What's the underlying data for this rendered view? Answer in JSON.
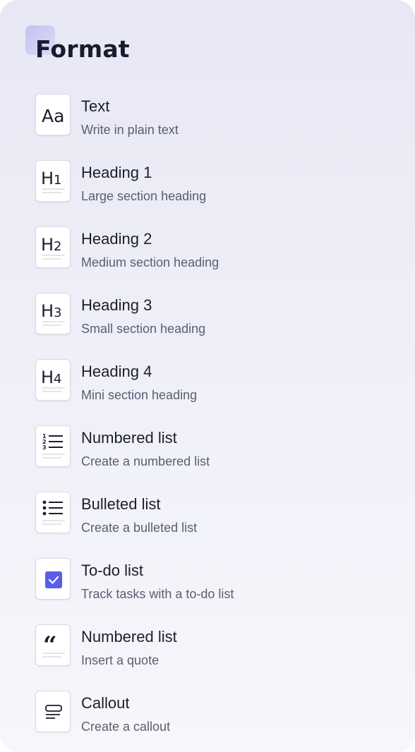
{
  "panel": {
    "title": "Format"
  },
  "colors": {
    "accent": "#5a5de8",
    "title": "#1a1b2e",
    "description": "#5b5e70"
  },
  "items": [
    {
      "icon": "text-icon",
      "label": "Text",
      "description": "Write in plain text"
    },
    {
      "icon": "heading-1-icon",
      "label": "Heading 1",
      "description": "Large section heading"
    },
    {
      "icon": "heading-2-icon",
      "label": "Heading 2",
      "description": "Medium section heading"
    },
    {
      "icon": "heading-3-icon",
      "label": "Heading 3",
      "description": "Small section heading"
    },
    {
      "icon": "heading-4-icon",
      "label": "Heading 4",
      "description": "Mini section heading"
    },
    {
      "icon": "numbered-list-icon",
      "label": "Numbered list",
      "description": "Create a numbered list"
    },
    {
      "icon": "bulleted-list-icon",
      "label": "Bulleted list",
      "description": "Create a bulleted list"
    },
    {
      "icon": "checkbox-icon",
      "label": "To-do list",
      "description": "Track tasks with a to-do list"
    },
    {
      "icon": "quote-icon",
      "label": "Numbered list",
      "description": "Insert a quote"
    },
    {
      "icon": "callout-icon",
      "label": "Callout",
      "description": "Create a callout"
    }
  ]
}
